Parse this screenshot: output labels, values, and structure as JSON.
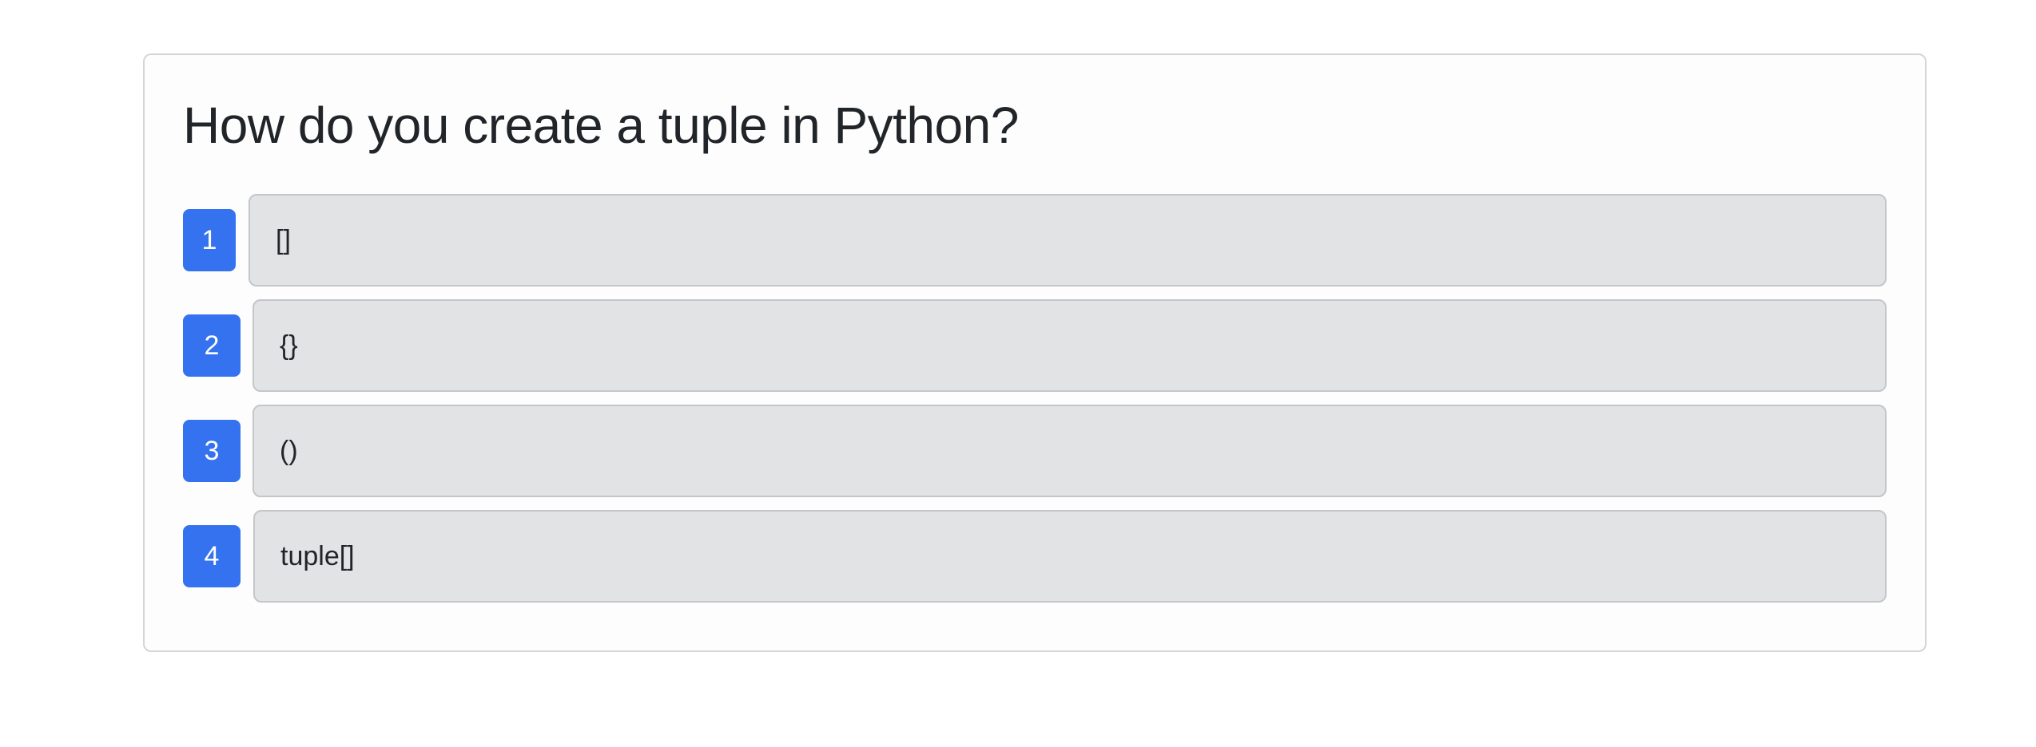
{
  "quiz": {
    "question": "How do you create a tuple in Python?",
    "options": [
      {
        "number": "1",
        "text": "[]"
      },
      {
        "number": "2",
        "text": "{}"
      },
      {
        "number": "3",
        "text": "()"
      },
      {
        "number": "4",
        "text": "tuple[]"
      }
    ]
  },
  "colors": {
    "badge_background": "#3572ef",
    "answer_background": "#e2e3e5",
    "card_border": "#d3d5d8"
  }
}
